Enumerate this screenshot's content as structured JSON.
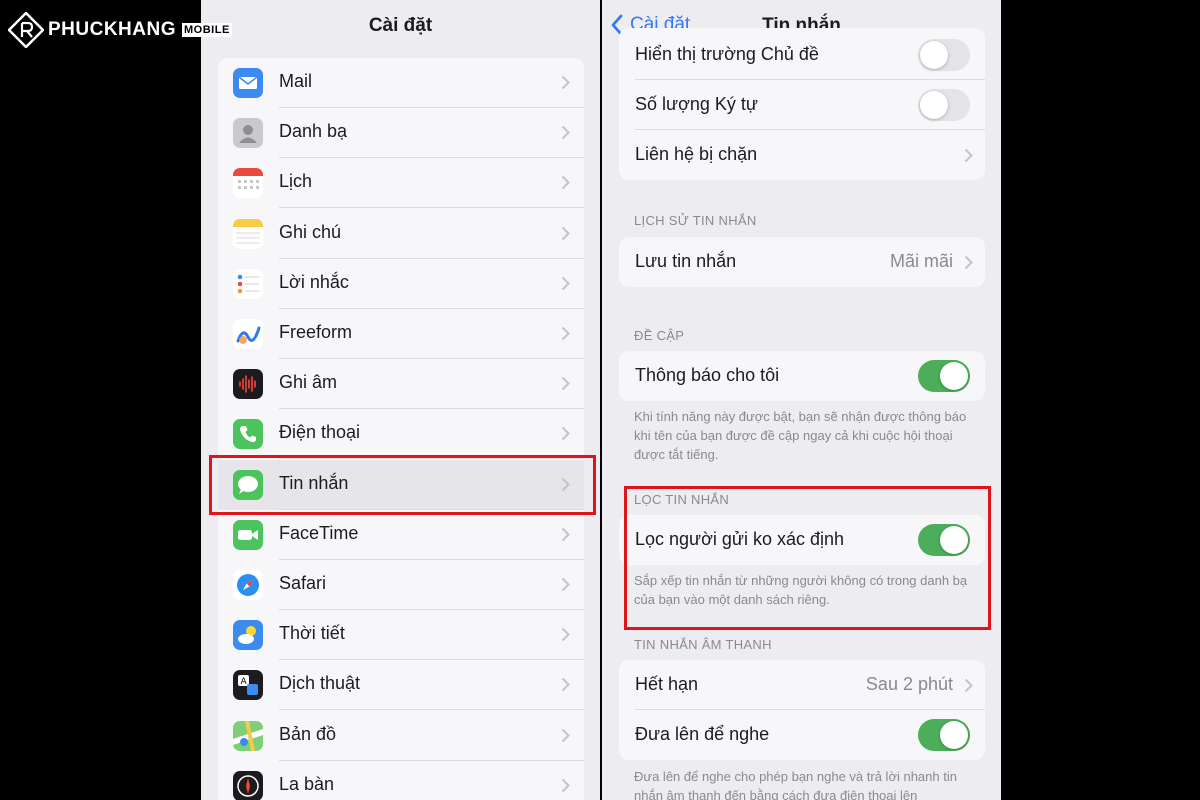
{
  "watermark": {
    "brand": "PHUCKHANG",
    "sub": "MOBILE"
  },
  "left": {
    "title": "Cài đặt",
    "items": [
      {
        "label": "Mail",
        "icon": "mail-icon"
      },
      {
        "label": "Danh bạ",
        "icon": "contacts-icon"
      },
      {
        "label": "Lịch",
        "icon": "calendar-icon"
      },
      {
        "label": "Ghi chú",
        "icon": "notes-icon"
      },
      {
        "label": "Lời nhắc",
        "icon": "reminders-icon"
      },
      {
        "label": "Freeform",
        "icon": "freeform-icon"
      },
      {
        "label": "Ghi âm",
        "icon": "voice-memos-icon"
      },
      {
        "label": "Điện thoại",
        "icon": "phone-icon"
      },
      {
        "label": "Tin nhắn",
        "icon": "messages-icon",
        "selected": true
      },
      {
        "label": "FaceTime",
        "icon": "facetime-icon"
      },
      {
        "label": "Safari",
        "icon": "safari-icon"
      },
      {
        "label": "Thời tiết",
        "icon": "weather-icon"
      },
      {
        "label": "Dịch thuật",
        "icon": "translate-icon"
      },
      {
        "label": "Bản đồ",
        "icon": "maps-icon"
      },
      {
        "label": "La bàn",
        "icon": "compass-icon"
      }
    ]
  },
  "right": {
    "back_label": "Cài đặt",
    "title": "Tin nhắn",
    "top_rows": [
      {
        "label": "Hiển thị trường Chủ đề",
        "toggle": false
      },
      {
        "label": "Số lượng Ký tự",
        "toggle": false
      },
      {
        "label": "Liên hệ bị chặn"
      }
    ],
    "history": {
      "header": "LỊCH SỬ TIN NHẮN",
      "row_label": "Lưu tin nhắn",
      "row_value": "Mãi mãi"
    },
    "mentions": {
      "header": "ĐỀ CẬP",
      "row_label": "Thông báo cho tôi",
      "toggle": true,
      "footnote": "Khi tính năng này được bật, bạn sẽ nhận được thông báo khi tên của bạn được đề cập ngay cả khi cuộc hội thoại được tắt tiếng."
    },
    "filter": {
      "header": "LỌC TIN NHẮN",
      "row_label": "Lọc người gửi ko xác định",
      "toggle": true,
      "footnote": "Sắp xếp tin nhắn từ những người không có trong danh bạ của bạn vào một danh sách riêng."
    },
    "audio": {
      "header": "TIN NHẮN ÂM THANH",
      "expire_label": "Hết hạn",
      "expire_value": "Sau 2 phút",
      "raise_label": "Đưa lên để nghe",
      "raise_toggle": true,
      "footnote": "Đưa lên để nghe cho phép bạn nghe và trả lời nhanh tin nhắn âm thanh đến bằng cách đưa điện thoại lên"
    }
  },
  "colors": {
    "accent": "#3478f6",
    "toggle_on": "#4cae5a",
    "highlight": "#e0151b",
    "background": "#ededf1"
  }
}
